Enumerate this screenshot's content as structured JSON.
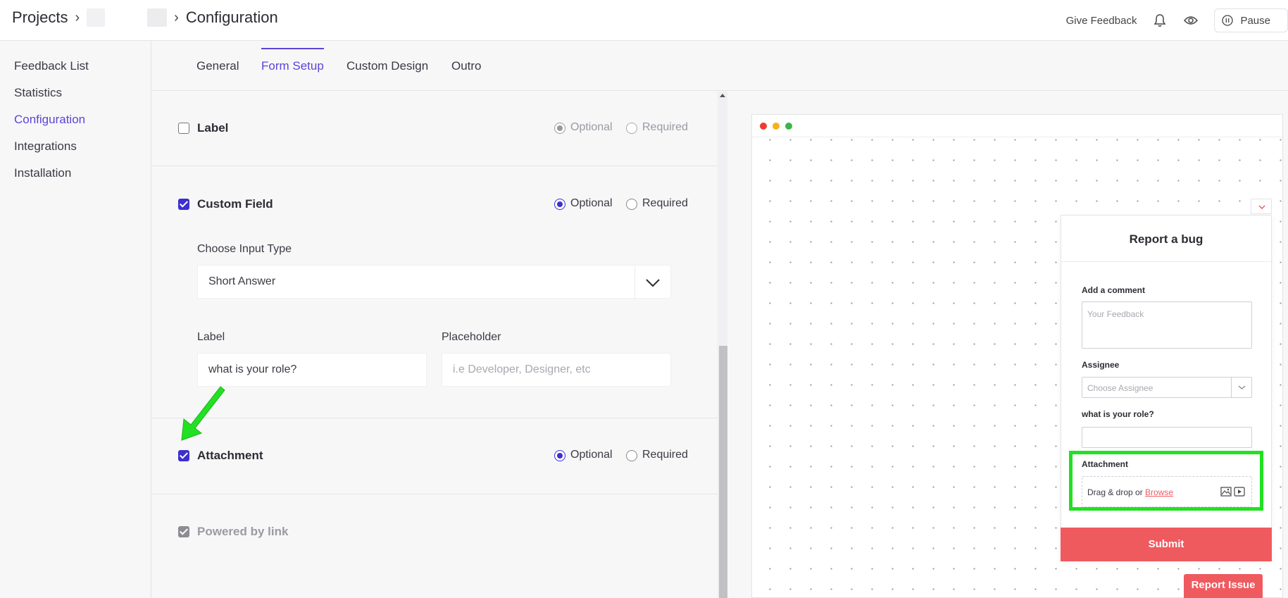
{
  "header": {
    "breadcrumb_root": "Projects",
    "breadcrumb_current": "Configuration",
    "give_feedback": "Give Feedback",
    "pause_label": "Pause"
  },
  "sidebar": {
    "items": [
      {
        "label": "Feedback List"
      },
      {
        "label": "Statistics"
      },
      {
        "label": "Configuration",
        "active": true
      },
      {
        "label": "Integrations"
      },
      {
        "label": "Installation"
      }
    ]
  },
  "tabs": [
    {
      "label": "General"
    },
    {
      "label": "Form Setup",
      "active": true
    },
    {
      "label": "Custom Design"
    },
    {
      "label": "Outro"
    }
  ],
  "form": {
    "label_row": {
      "title": "Label",
      "checked": false,
      "optional": "Optional",
      "required": "Required"
    },
    "custom_field": {
      "title": "Custom Field",
      "checked": true,
      "optional": "Optional",
      "required": "Required",
      "input_type_label": "Choose Input Type",
      "input_type_value": "Short Answer",
      "label_label": "Label",
      "label_value": "what is your role?",
      "placeholder_label": "Placeholder",
      "placeholder_hint": "i.e Developer, Designer, etc"
    },
    "attachment": {
      "title": "Attachment",
      "checked": true,
      "optional": "Optional",
      "required": "Required"
    },
    "powered_by": {
      "title": "Powered by link",
      "checked": true,
      "disabled": true
    }
  },
  "preview": {
    "widget_title": "Report a bug",
    "comment_label": "Add a comment",
    "comment_placeholder": "Your Feedback",
    "assignee_label": "Assignee",
    "assignee_placeholder": "Choose Assignee",
    "custom_label": "what is your role?",
    "attachment_label": "Attachment",
    "attachment_text": "Drag & drop or",
    "attachment_browse": "Browse",
    "submit_label": "Submit",
    "report_issue_label": "Report Issue"
  },
  "colors": {
    "accent": "#5b45d6",
    "checkbox": "#3d2fd0",
    "brand_red": "#ef5a5f",
    "highlight_green": "#22e022"
  }
}
